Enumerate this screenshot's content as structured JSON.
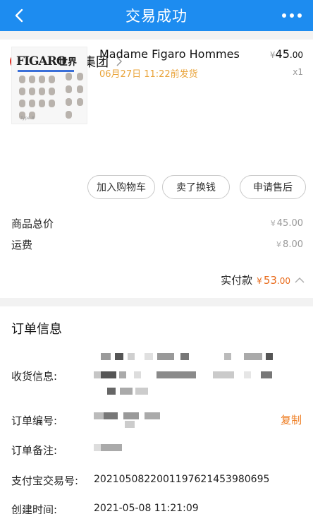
{
  "nav": {
    "title": "交易成功"
  },
  "shop": {
    "name": "精品传媒集团",
    "badge": "企"
  },
  "product": {
    "title": "Madame Figaro Hommes",
    "ship_note": "06月27日 11:22前发货",
    "price_symbol": "¥",
    "price_int": "45",
    "price_dec": ".00",
    "qty": "x1",
    "cover_title": "FIGARO",
    "cover_title_cn": "世界",
    "cover_type": "Type B"
  },
  "actions": {
    "add_cart": "加入购物车",
    "sell": "卖了换钱",
    "after_sale": "申请售后"
  },
  "fees": {
    "total_label": "商品总价",
    "total_value": "45.00",
    "shipping_label": "运费",
    "shipping_value": "8.00",
    "currency": "¥"
  },
  "paid": {
    "label": "实付款",
    "symbol": "¥",
    "int": "53",
    "dec": ".00"
  },
  "order": {
    "section_title": "订单信息",
    "address_label": "收货信息:",
    "order_no_label": "订单编号:",
    "copy_label": "复制",
    "remark_label": "订单备注:",
    "alipay_label": "支付宝交易号:",
    "alipay_value": "2021050822001197621453980695",
    "created_label": "创建时间:",
    "created_value": "2021-05-08 11:21:09"
  },
  "colors": {
    "nav_bg": "#1d8cf0",
    "accent_orange": "#e86a1a",
    "ship_note": "#e9a339",
    "badge_red": "#e02e24"
  },
  "icons": {
    "back": "chevron-left-icon",
    "more": "more-dots-icon",
    "shop_badge": "enterprise-badge-icon",
    "shop_chevron": "chevron-right-icon",
    "paid_chevron": "chevron-up-icon"
  }
}
